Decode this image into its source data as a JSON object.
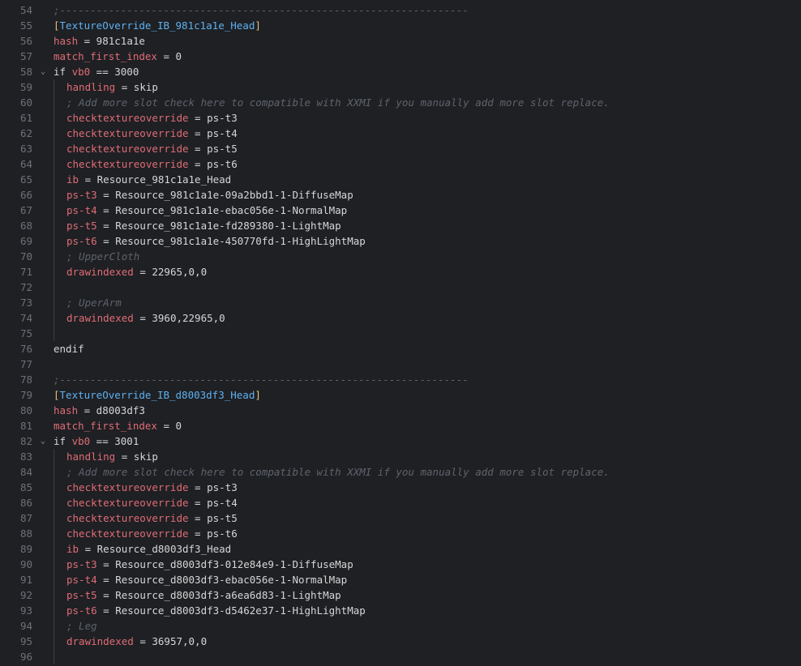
{
  "editor": {
    "lines": [
      {
        "num": "54",
        "indent": false,
        "fold": "",
        "tokens": [
          {
            "t": "cm",
            "v": ";-------------------------------------------------------------------"
          }
        ]
      },
      {
        "num": "55",
        "indent": false,
        "fold": "",
        "tokens": [
          {
            "t": "br",
            "v": "["
          },
          {
            "t": "sec",
            "v": "TextureOverride_IB_981c1a1e_Head"
          },
          {
            "t": "br",
            "v": "]"
          }
        ]
      },
      {
        "num": "56",
        "indent": false,
        "fold": "",
        "tokens": [
          {
            "t": "key",
            "v": "hash"
          },
          {
            "t": "txt",
            "v": " = 981c1a1e"
          }
        ]
      },
      {
        "num": "57",
        "indent": false,
        "fold": "",
        "tokens": [
          {
            "t": "key",
            "v": "match_first_index"
          },
          {
            "t": "txt",
            "v": " = 0"
          }
        ]
      },
      {
        "num": "58",
        "indent": false,
        "fold": "⌄",
        "tokens": [
          {
            "t": "txt",
            "v": "if "
          },
          {
            "t": "key",
            "v": "vb0"
          },
          {
            "t": "txt",
            "v": " == 3000"
          }
        ]
      },
      {
        "num": "59",
        "indent": true,
        "fold": "",
        "tokens": [
          {
            "t": "key",
            "v": "handling"
          },
          {
            "t": "txt",
            "v": " = skip"
          }
        ]
      },
      {
        "num": "60",
        "indent": true,
        "fold": "",
        "tokens": [
          {
            "t": "cm",
            "v": "; Add more slot check here to compatible with XXMI if you manually add more slot replace."
          }
        ]
      },
      {
        "num": "61",
        "indent": true,
        "fold": "",
        "tokens": [
          {
            "t": "key",
            "v": "checktextureoverride"
          },
          {
            "t": "txt",
            "v": " = ps-t3"
          }
        ]
      },
      {
        "num": "62",
        "indent": true,
        "fold": "",
        "tokens": [
          {
            "t": "key",
            "v": "checktextureoverride"
          },
          {
            "t": "txt",
            "v": " = ps-t4"
          }
        ]
      },
      {
        "num": "63",
        "indent": true,
        "fold": "",
        "tokens": [
          {
            "t": "key",
            "v": "checktextureoverride"
          },
          {
            "t": "txt",
            "v": " = ps-t5"
          }
        ]
      },
      {
        "num": "64",
        "indent": true,
        "fold": "",
        "tokens": [
          {
            "t": "key",
            "v": "checktextureoverride"
          },
          {
            "t": "txt",
            "v": " = ps-t6"
          }
        ]
      },
      {
        "num": "65",
        "indent": true,
        "fold": "",
        "tokens": [
          {
            "t": "key",
            "v": "ib"
          },
          {
            "t": "txt",
            "v": " = Resource_981c1a1e_Head"
          }
        ]
      },
      {
        "num": "66",
        "indent": true,
        "fold": "",
        "tokens": [
          {
            "t": "key",
            "v": "ps-t3"
          },
          {
            "t": "txt",
            "v": " = Resource_981c1a1e-09a2bbd1-1-DiffuseMap"
          }
        ]
      },
      {
        "num": "67",
        "indent": true,
        "fold": "",
        "tokens": [
          {
            "t": "key",
            "v": "ps-t4"
          },
          {
            "t": "txt",
            "v": " = Resource_981c1a1e-ebac056e-1-NormalMap"
          }
        ]
      },
      {
        "num": "68",
        "indent": true,
        "fold": "",
        "tokens": [
          {
            "t": "key",
            "v": "ps-t5"
          },
          {
            "t": "txt",
            "v": " = Resource_981c1a1e-fd289380-1-LightMap"
          }
        ]
      },
      {
        "num": "69",
        "indent": true,
        "fold": "",
        "tokens": [
          {
            "t": "key",
            "v": "ps-t6"
          },
          {
            "t": "txt",
            "v": " = Resource_981c1a1e-450770fd-1-HighLightMap"
          }
        ]
      },
      {
        "num": "70",
        "indent": true,
        "fold": "",
        "tokens": [
          {
            "t": "cm",
            "v": "; UpperCloth"
          }
        ]
      },
      {
        "num": "71",
        "indent": true,
        "fold": "",
        "tokens": [
          {
            "t": "key",
            "v": "drawindexed"
          },
          {
            "t": "txt",
            "v": " = 22965,0,0"
          }
        ]
      },
      {
        "num": "72",
        "indent": true,
        "fold": "",
        "tokens": []
      },
      {
        "num": "73",
        "indent": true,
        "fold": "",
        "tokens": [
          {
            "t": "cm",
            "v": "; UperArm"
          }
        ]
      },
      {
        "num": "74",
        "indent": true,
        "fold": "",
        "tokens": [
          {
            "t": "key",
            "v": "drawindexed"
          },
          {
            "t": "txt",
            "v": " = 3960,22965,0"
          }
        ]
      },
      {
        "num": "75",
        "indent": true,
        "fold": "",
        "tokens": []
      },
      {
        "num": "76",
        "indent": false,
        "fold": "",
        "tokens": [
          {
            "t": "txt",
            "v": "endif"
          }
        ]
      },
      {
        "num": "77",
        "indent": false,
        "fold": "",
        "tokens": []
      },
      {
        "num": "78",
        "indent": false,
        "fold": "",
        "tokens": [
          {
            "t": "cm",
            "v": ";-------------------------------------------------------------------"
          }
        ]
      },
      {
        "num": "79",
        "indent": false,
        "fold": "",
        "tokens": [
          {
            "t": "br",
            "v": "["
          },
          {
            "t": "sec",
            "v": "TextureOverride_IB_d8003df3_Head"
          },
          {
            "t": "br",
            "v": "]"
          }
        ]
      },
      {
        "num": "80",
        "indent": false,
        "fold": "",
        "tokens": [
          {
            "t": "key",
            "v": "hash"
          },
          {
            "t": "txt",
            "v": " = d8003df3"
          }
        ]
      },
      {
        "num": "81",
        "indent": false,
        "fold": "",
        "tokens": [
          {
            "t": "key",
            "v": "match_first_index"
          },
          {
            "t": "txt",
            "v": " = 0"
          }
        ]
      },
      {
        "num": "82",
        "indent": false,
        "fold": "⌄",
        "tokens": [
          {
            "t": "txt",
            "v": "if "
          },
          {
            "t": "key",
            "v": "vb0"
          },
          {
            "t": "txt",
            "v": " == 3001"
          }
        ]
      },
      {
        "num": "83",
        "indent": true,
        "fold": "",
        "tokens": [
          {
            "t": "key",
            "v": "handling"
          },
          {
            "t": "txt",
            "v": " = skip"
          }
        ]
      },
      {
        "num": "84",
        "indent": true,
        "fold": "",
        "tokens": [
          {
            "t": "cm",
            "v": "; Add more slot check here to compatible with XXMI if you manually add more slot replace."
          }
        ]
      },
      {
        "num": "85",
        "indent": true,
        "fold": "",
        "tokens": [
          {
            "t": "key",
            "v": "checktextureoverride"
          },
          {
            "t": "txt",
            "v": " = ps-t3"
          }
        ]
      },
      {
        "num": "86",
        "indent": true,
        "fold": "",
        "tokens": [
          {
            "t": "key",
            "v": "checktextureoverride"
          },
          {
            "t": "txt",
            "v": " = ps-t4"
          }
        ]
      },
      {
        "num": "87",
        "indent": true,
        "fold": "",
        "tokens": [
          {
            "t": "key",
            "v": "checktextureoverride"
          },
          {
            "t": "txt",
            "v": " = ps-t5"
          }
        ]
      },
      {
        "num": "88",
        "indent": true,
        "fold": "",
        "tokens": [
          {
            "t": "key",
            "v": "checktextureoverride"
          },
          {
            "t": "txt",
            "v": " = ps-t6"
          }
        ]
      },
      {
        "num": "89",
        "indent": true,
        "fold": "",
        "tokens": [
          {
            "t": "key",
            "v": "ib"
          },
          {
            "t": "txt",
            "v": " = Resource_d8003df3_Head"
          }
        ]
      },
      {
        "num": "90",
        "indent": true,
        "fold": "",
        "tokens": [
          {
            "t": "key",
            "v": "ps-t3"
          },
          {
            "t": "txt",
            "v": " = Resource_d8003df3-012e84e9-1-DiffuseMap"
          }
        ]
      },
      {
        "num": "91",
        "indent": true,
        "fold": "",
        "tokens": [
          {
            "t": "key",
            "v": "ps-t4"
          },
          {
            "t": "txt",
            "v": " = Resource_d8003df3-ebac056e-1-NormalMap"
          }
        ]
      },
      {
        "num": "92",
        "indent": true,
        "fold": "",
        "tokens": [
          {
            "t": "key",
            "v": "ps-t5"
          },
          {
            "t": "txt",
            "v": " = Resource_d8003df3-a6ea6d83-1-LightMap"
          }
        ]
      },
      {
        "num": "93",
        "indent": true,
        "fold": "",
        "tokens": [
          {
            "t": "key",
            "v": "ps-t6"
          },
          {
            "t": "txt",
            "v": " = Resource_d8003df3-d5462e37-1-HighLightMap"
          }
        ]
      },
      {
        "num": "94",
        "indent": true,
        "fold": "",
        "tokens": [
          {
            "t": "cm",
            "v": "; Leg"
          }
        ]
      },
      {
        "num": "95",
        "indent": true,
        "fold": "",
        "tokens": [
          {
            "t": "key",
            "v": "drawindexed"
          },
          {
            "t": "txt",
            "v": " = 36957,0,0"
          }
        ]
      },
      {
        "num": "96",
        "indent": true,
        "fold": "",
        "tokens": []
      }
    ]
  },
  "colors": {
    "background": "#1e2024",
    "line_number": "#6d7178",
    "key": "#e06c75",
    "section": "#5fb0ee",
    "bracket": "#e5c07b",
    "comment": "#5e636b",
    "text": "#d6d6d6"
  },
  "icons": {
    "fold": "chevron-down-icon"
  }
}
